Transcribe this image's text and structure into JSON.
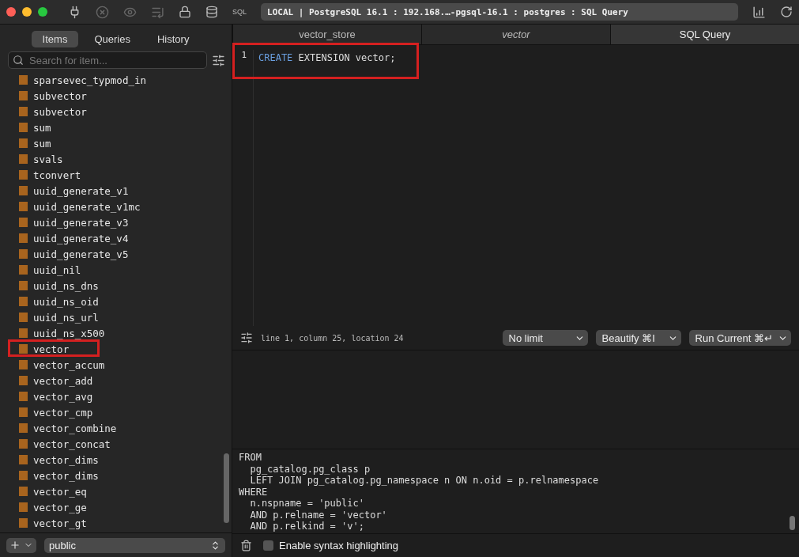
{
  "window": {
    "connection": "LOCAL | PostgreSQL 16.1 : 192.168.…-pgsql-16.1 : postgres : SQL Query",
    "sql_label": "SQL"
  },
  "sidebar": {
    "tabs": [
      {
        "label": "Items",
        "selected": true
      },
      {
        "label": "Queries",
        "selected": false
      },
      {
        "label": "History",
        "selected": false
      }
    ],
    "search": {
      "placeholder": "Search for item..."
    },
    "items": [
      {
        "label": "sparsevec_typmod_in",
        "highlighted": false
      },
      {
        "label": "subvector",
        "highlighted": false
      },
      {
        "label": "subvector",
        "highlighted": false
      },
      {
        "label": "sum",
        "highlighted": false
      },
      {
        "label": "sum",
        "highlighted": false
      },
      {
        "label": "svals",
        "highlighted": false
      },
      {
        "label": "tconvert",
        "highlighted": false
      },
      {
        "label": "uuid_generate_v1",
        "highlighted": false
      },
      {
        "label": "uuid_generate_v1mc",
        "highlighted": false
      },
      {
        "label": "uuid_generate_v3",
        "highlighted": false
      },
      {
        "label": "uuid_generate_v4",
        "highlighted": false
      },
      {
        "label": "uuid_generate_v5",
        "highlighted": false
      },
      {
        "label": "uuid_nil",
        "highlighted": false
      },
      {
        "label": "uuid_ns_dns",
        "highlighted": false
      },
      {
        "label": "uuid_ns_oid",
        "highlighted": false
      },
      {
        "label": "uuid_ns_url",
        "highlighted": false
      },
      {
        "label": "uuid_ns_x500",
        "highlighted": false
      },
      {
        "label": "vector",
        "highlighted": true
      },
      {
        "label": "vector_accum",
        "highlighted": false
      },
      {
        "label": "vector_add",
        "highlighted": false
      },
      {
        "label": "vector_avg",
        "highlighted": false
      },
      {
        "label": "vector_cmp",
        "highlighted": false
      },
      {
        "label": "vector_combine",
        "highlighted": false
      },
      {
        "label": "vector_concat",
        "highlighted": false
      },
      {
        "label": "vector_dims",
        "highlighted": false
      },
      {
        "label": "vector_dims",
        "highlighted": false
      },
      {
        "label": "vector_eq",
        "highlighted": false
      },
      {
        "label": "vector_ge",
        "highlighted": false
      },
      {
        "label": "vector_gt",
        "highlighted": false
      }
    ],
    "schema": "public"
  },
  "editor_tabs": [
    {
      "label": "vector_store",
      "selected": false,
      "italic": false
    },
    {
      "label": "vector",
      "selected": false,
      "italic": true
    },
    {
      "label": "SQL Query",
      "selected": true,
      "italic": false
    }
  ],
  "editor": {
    "highlighted": true,
    "lines": [
      {
        "number": "1",
        "tokens": [
          {
            "text": "CREATE",
            "kind": "keyword"
          },
          {
            "text": " EXTENSION vector;",
            "kind": "plain"
          }
        ]
      }
    ]
  },
  "status": {
    "cursor": "line 1, column 25, location 24",
    "buttons": [
      "No limit",
      "Beautify ⌘I",
      "Run Current ⌘↵"
    ]
  },
  "log": {
    "lines": [
      "FROM",
      "  pg_catalog.pg_class p",
      "  LEFT JOIN pg_catalog.pg_namespace n ON n.oid = p.relnamespace",
      "WHERE",
      "  n.nspname = 'public'",
      "  AND p.relname = 'vector'",
      "  AND p.relkind = 'v';"
    ],
    "syntax_highlighting": {
      "label": "Enable syntax highlighting",
      "checked": false
    }
  }
}
